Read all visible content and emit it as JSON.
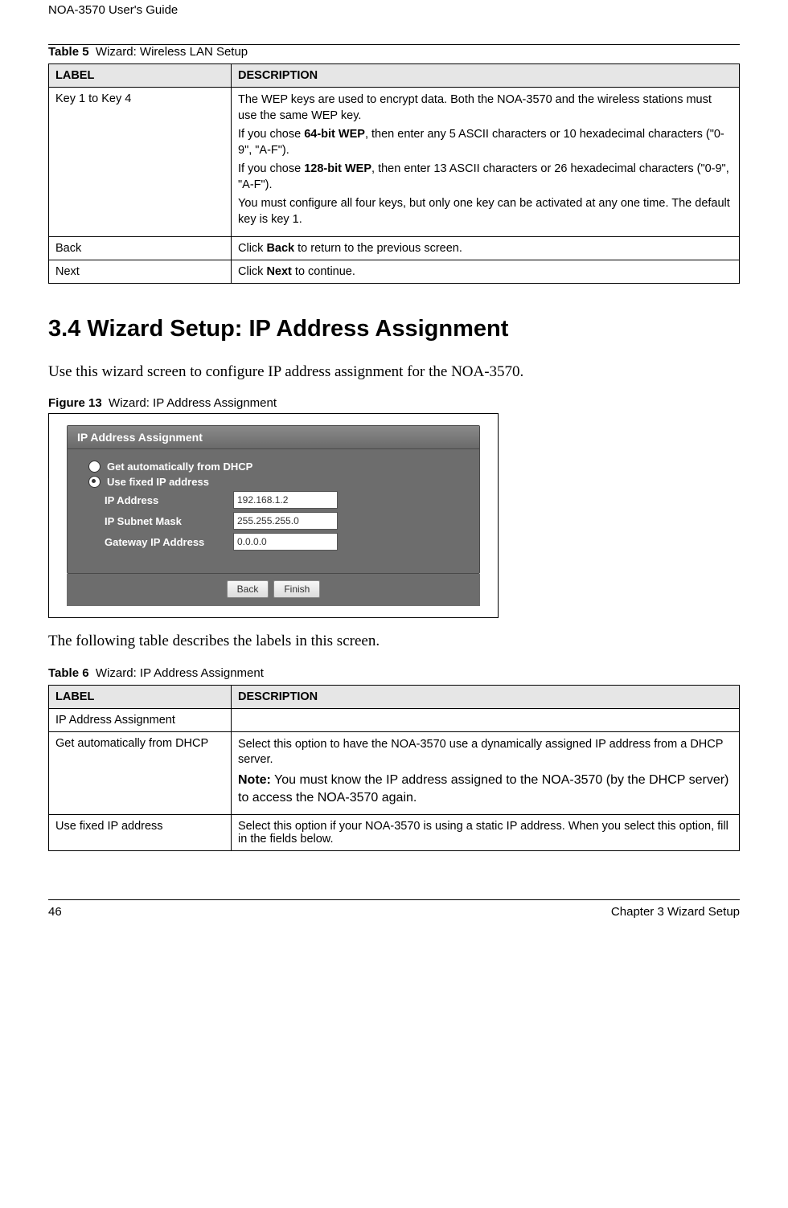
{
  "header": "NOA-3570 User's Guide",
  "footer": {
    "page": "46",
    "chapter": "Chapter 3 Wizard Setup"
  },
  "table5": {
    "caption_label": "Table 5",
    "caption_text": "Wizard: Wireless LAN Setup",
    "headers": {
      "label": "LABEL",
      "desc": "DESCRIPTION"
    },
    "rows": {
      "key": {
        "label": "Key 1 to Key 4",
        "p1": "The WEP keys are used to encrypt data. Both the NOA-3570 and the wireless stations must use the same WEP key.",
        "p2a": "If you chose ",
        "p2b": "64-bit WEP",
        "p2c": ", then enter any 5 ASCII characters or 10 hexadecimal characters (\"0-9\", \"A-F\").",
        "p3a": "If you chose ",
        "p3b": "128-bit WEP",
        "p3c": ", then enter 13 ASCII characters or 26 hexadecimal characters (\"0-9\", \"A-F\").",
        "p4": "You must configure all four keys, but only one key can be activated at any one time. The default key is key 1."
      },
      "back": {
        "label": "Back",
        "d1": "Click ",
        "d2": "Back",
        "d3": " to return to the previous screen."
      },
      "next": {
        "label": "Next",
        "d1": "Click ",
        "d2": "Next",
        "d3": " to continue."
      }
    }
  },
  "section": {
    "heading": "3.4  Wizard Setup: IP Address Assignment",
    "intro": "Use this wizard screen to configure IP address assignment for the NOA-3570."
  },
  "figure": {
    "caption_label": "Figure 13",
    "caption_text": "Wizard: IP Address Assignment",
    "panel_title": "IP Address Assignment",
    "radio_dhcp": "Get automatically from DHCP",
    "radio_fixed": "Use fixed IP address",
    "fields": {
      "ip_label": "IP Address",
      "ip_value": "192.168.1.2",
      "mask_label": "IP Subnet Mask",
      "mask_value": "255.255.255.0",
      "gw_label": "Gateway IP Address",
      "gw_value": "0.0.0.0"
    },
    "buttons": {
      "back": "Back",
      "finish": "Finish"
    }
  },
  "after_figure": "The following table describes the labels in this screen.",
  "table6": {
    "caption_label": "Table 6",
    "caption_text": "Wizard: IP Address Assignment",
    "headers": {
      "label": "LABEL",
      "desc": "DESCRIPTION"
    },
    "rows": {
      "sect": {
        "label": "IP Address Assignment",
        "desc": ""
      },
      "dhcp": {
        "label": "Get automatically from DHCP",
        "p1": "Select this option to have the NOA-3570 use a dynamically assigned IP address from a DHCP server.",
        "note_b": "Note:",
        "note_t": " You must know the IP address assigned to the NOA-3570 (by the DHCP server) to access the NOA-3570 again."
      },
      "fixed": {
        "label": "Use fixed IP address",
        "desc": "Select this option if your NOA-3570 is using a static IP address. When you select this option, fill in the fields below."
      }
    }
  }
}
